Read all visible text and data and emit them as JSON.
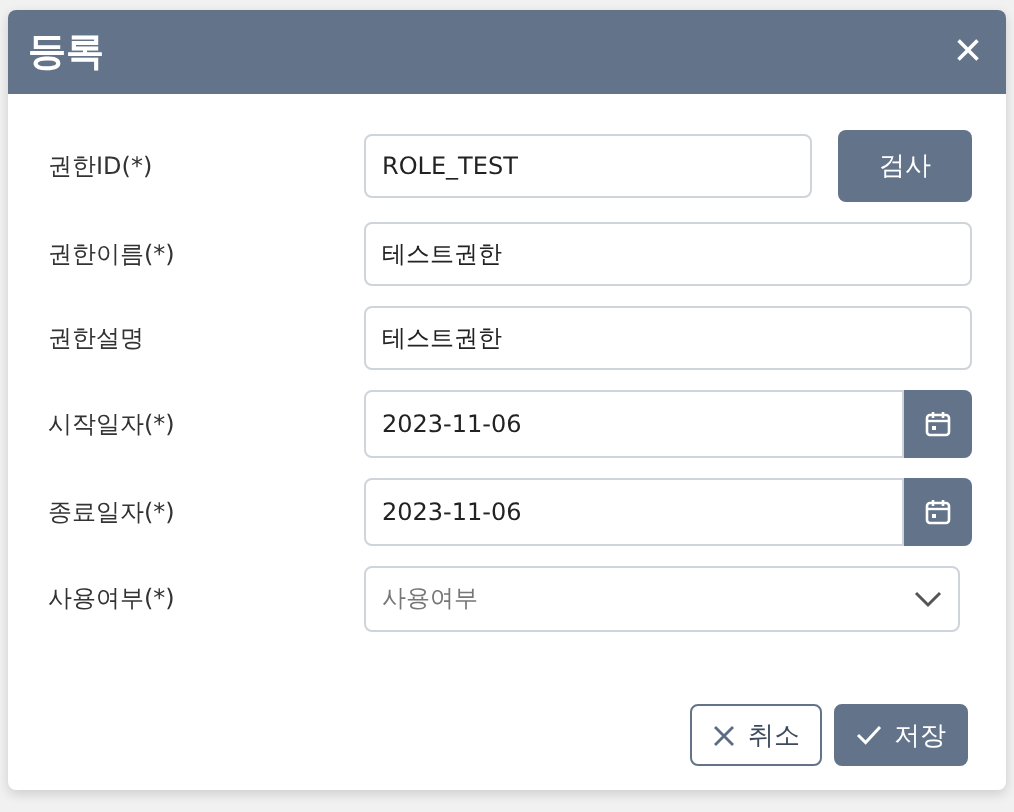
{
  "dialog": {
    "title": "등록",
    "close": "×"
  },
  "fields": [
    {
      "kind": "text",
      "label": "권한ID(*)",
      "value": "ROLE_TEST",
      "button": "검사"
    },
    {
      "kind": "text",
      "label": "권한이름(*)",
      "value": "테스트권한"
    },
    {
      "kind": "text",
      "label": "권한설명",
      "value": "테스트권한"
    },
    {
      "kind": "date",
      "label": "시작일자(*)",
      "value": "2023-11-06"
    },
    {
      "kind": "date",
      "label": "종료일자(*)",
      "value": "2023-11-06"
    },
    {
      "kind": "select",
      "label": "사용여부(*)",
      "placeholder": "사용여부"
    }
  ],
  "buttons": [
    {
      "kind": "cancel",
      "label": "취소"
    },
    {
      "kind": "save",
      "label": "저장"
    }
  ]
}
